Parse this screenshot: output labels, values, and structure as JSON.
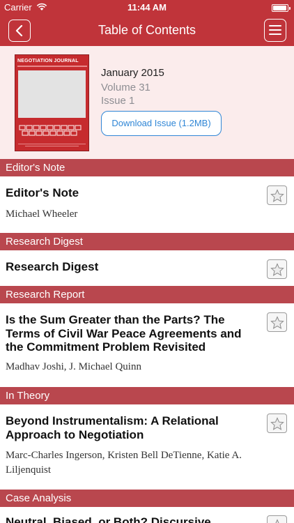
{
  "status_bar": {
    "carrier": "Carrier",
    "time": "11:44 AM",
    "battery_level": 0.95
  },
  "nav": {
    "title": "Table of Contents",
    "back_icon": "chevron-left-icon",
    "menu_icon": "hamburger-menu-icon"
  },
  "issue": {
    "cover_title": "NEGOTIATION JOURNAL",
    "date": "January 2015",
    "volume": "Volume 31",
    "number": "Issue 1",
    "download_label": "Download Issue (1.2MB)"
  },
  "sections": [
    {
      "header": "Editor's Note",
      "articles": [
        {
          "title": "Editor's Note",
          "authors": "Michael Wheeler"
        }
      ]
    },
    {
      "header": "Research Digest",
      "articles": [
        {
          "title": "Research Digest",
          "authors": ""
        }
      ]
    },
    {
      "header": "Research Report",
      "articles": [
        {
          "title": "Is the Sum Greater than the Parts? The Terms of Civil War Peace Agreements and the Commitment Problem Revisited",
          "authors": "Madhav Joshi, J. Michael Quinn"
        }
      ]
    },
    {
      "header": "In Theory",
      "articles": [
        {
          "title": "Beyond Instrumentalism: A Relational Approach to Negotiation",
          "authors": "Marc-Charles Ingerson, Kristen Bell DeTienne, Katie A. Liljenquist"
        }
      ]
    },
    {
      "header": "Case Analysis",
      "articles": [
        {
          "title": "Neutral, Biased, or Both? Discursive",
          "authors": ""
        }
      ]
    }
  ],
  "colors": {
    "brand": "#c0343a",
    "section_header": "#b9474e",
    "header_bg": "#fbecec",
    "link": "#2f86d6"
  },
  "icons": {
    "star": "star-icon",
    "wifi": "wifi-icon",
    "battery": "battery-icon"
  }
}
